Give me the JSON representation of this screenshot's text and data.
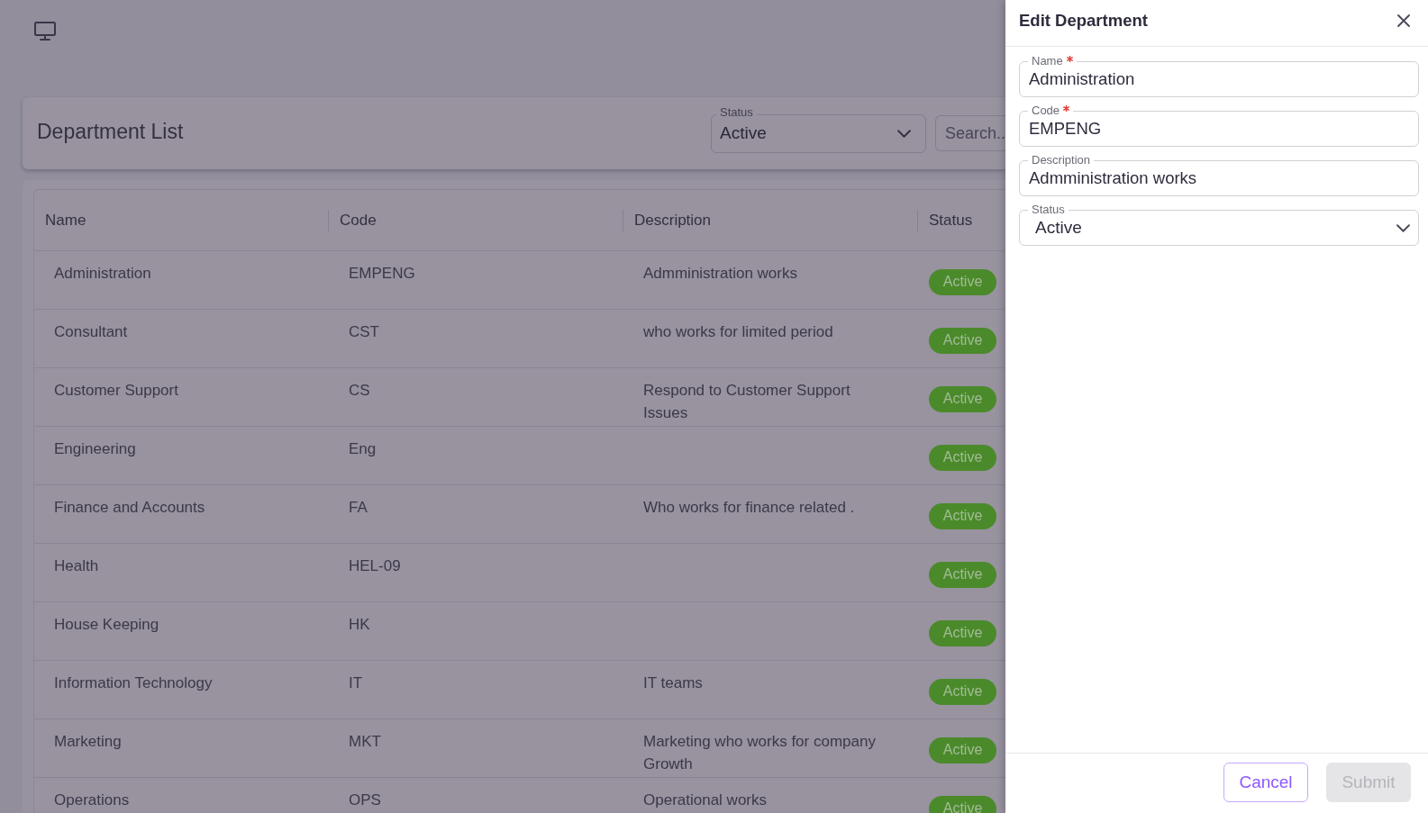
{
  "page": {
    "title": "Department List",
    "status_filter": {
      "label": "Status",
      "value": "Active"
    },
    "search": {
      "placeholder": "Search.."
    }
  },
  "table": {
    "columns": [
      "Name",
      "Code",
      "Description",
      "Status"
    ],
    "rows": [
      {
        "name": "Administration",
        "code": "EMPENG",
        "description": "Admministration works",
        "status": "Active"
      },
      {
        "name": "Consultant",
        "code": "CST",
        "description": "who works for limited period",
        "status": "Active"
      },
      {
        "name": "Customer Support",
        "code": "CS",
        "description": "Respond to Customer Support Issues",
        "status": "Active"
      },
      {
        "name": "Engineering",
        "code": "Eng",
        "status": "Active"
      },
      {
        "name": "Finance and Accounts",
        "code": "FA",
        "description": "Who works for finance related .",
        "status": "Active"
      },
      {
        "name": "Health",
        "code": "HEL-09",
        "status": "Active"
      },
      {
        "name": "House Keeping",
        "code": "HK",
        "status": "Active"
      },
      {
        "name": "Information Technology",
        "code": "IT",
        "description": "IT teams",
        "status": "Active"
      },
      {
        "name": "Marketing",
        "code": "MKT",
        "description": "Marketing who works for company Growth",
        "status": "Active"
      },
      {
        "name": "Operations",
        "code": "OPS",
        "description": "Operational works",
        "status": "Active"
      }
    ]
  },
  "drawer": {
    "title": "Edit Department",
    "fields": [
      {
        "kind": "text",
        "label": "Name",
        "required": true,
        "value": "Administration"
      },
      {
        "kind": "text",
        "label": "Code",
        "required": true,
        "value": "EMPENG"
      },
      {
        "kind": "text",
        "label": "Description",
        "required": false,
        "value": "Admministration works"
      },
      {
        "kind": "select",
        "label": "Status",
        "required": false,
        "value": "Active"
      }
    ],
    "buttons": [
      {
        "kind": "outlined",
        "label": "Cancel",
        "disabled": false
      },
      {
        "kind": "filled",
        "label": "Submit",
        "disabled": true
      }
    ]
  }
}
